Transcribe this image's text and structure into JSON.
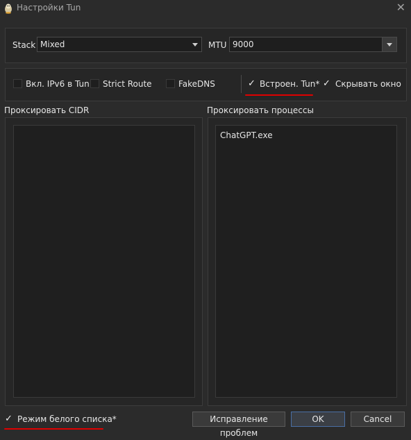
{
  "window": {
    "title": "Настройки Tun",
    "close_glyph": "✕",
    "app_icon": "tux-icon"
  },
  "top": {
    "stack_label": "Stack",
    "stack_value": "Mixed",
    "mtu_label": "MTU",
    "mtu_value": "9000"
  },
  "options": {
    "ipv6": {
      "label": "Вкл. IPv6 в Tun",
      "checked": false
    },
    "strict_route": {
      "label": "Strict Route",
      "checked": false
    },
    "fakedns": {
      "label": "FakeDNS",
      "checked": false
    },
    "builtin_tun": {
      "label": "Встроен. Tun*",
      "checked": true
    },
    "hide_window": {
      "label": "Скрывать окно",
      "checked": true
    },
    "check_glyph": "✓"
  },
  "cidr": {
    "label": "Проксировать CIDR",
    "items": []
  },
  "processes": {
    "label": "Проксировать процессы",
    "items": [
      "ChatGPT.exe"
    ]
  },
  "bottom": {
    "whitelist": {
      "label": "Режим белого списка*",
      "checked": true
    },
    "fix_label": "Исправление проблем",
    "ok_label": "OK",
    "cancel_label": "Cancel"
  },
  "colors": {
    "annotation": "#e00000",
    "primary_border": "#4a6fa5"
  }
}
